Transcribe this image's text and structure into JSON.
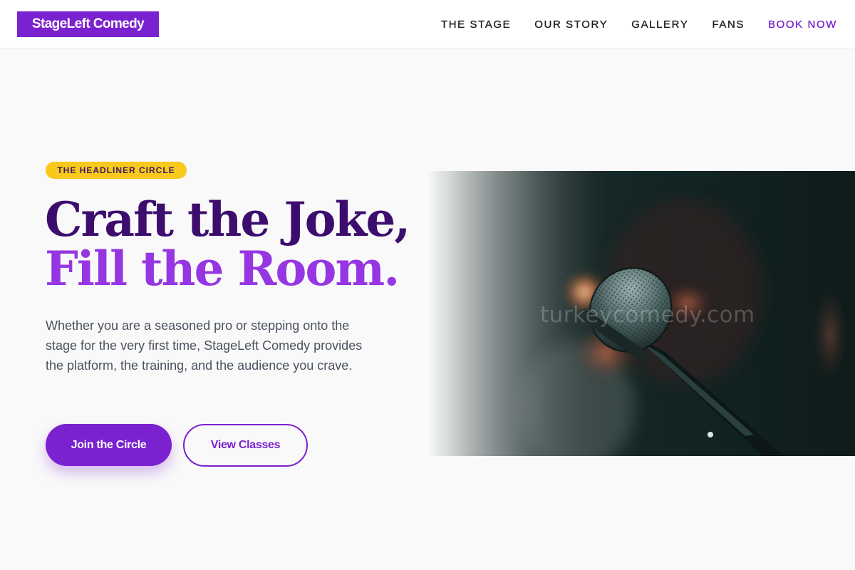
{
  "brand": {
    "logo_text": "StageLeft Comedy",
    "accent_color": "#7a22cf",
    "badge_color": "#f8c91c"
  },
  "nav": {
    "items": [
      {
        "label": "THE STAGE"
      },
      {
        "label": "OUR STORY"
      },
      {
        "label": "GALLERY"
      },
      {
        "label": "FANS"
      },
      {
        "label": "BOOK NOW"
      }
    ]
  },
  "hero": {
    "badge": "THE HEADLINER CIRCLE",
    "headline_line1": "Craft the Joke,",
    "headline_line2": "Fill the Room.",
    "lede": "Whether you are a seasoned pro or stepping onto the stage for the very first time, StageLeft Comedy provides the platform, the training, and the audience you crave.",
    "primary_button": "Join the Circle",
    "secondary_button": "View Classes",
    "image": {
      "subject": "microphone-icon",
      "watermark": "turkeycomedy.com"
    }
  }
}
